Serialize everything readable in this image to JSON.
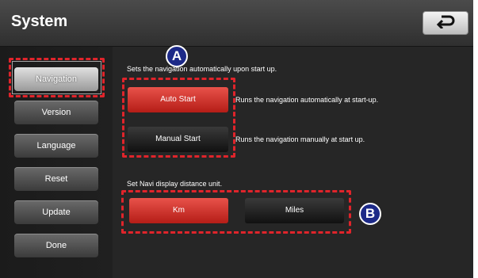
{
  "header": {
    "title": "System",
    "back_icon": "back-arrow-icon"
  },
  "sidebar": {
    "items": [
      {
        "label": "Navigation",
        "active": true
      },
      {
        "label": "Version",
        "active": false
      },
      {
        "label": "Language",
        "active": false
      },
      {
        "label": "Reset",
        "active": false
      },
      {
        "label": "Update",
        "active": false
      },
      {
        "label": "Done",
        "active": false
      }
    ]
  },
  "autostart": {
    "prompt": "Sets the navigation automatically upon start up.",
    "auto_label": "Auto Start",
    "auto_desc": "Runs the navigation automatically at start-up.",
    "manual_label": "Manual Start",
    "manual_desc": "Runs the navigation manually at start up."
  },
  "distance": {
    "prompt": "Set Navi display distance unit.",
    "km_label": "Km",
    "miles_label": "Miles"
  },
  "callouts": {
    "a": "A",
    "b": "B"
  },
  "colors": {
    "highlight_dash": "#e0242b",
    "selected_option": "#c8282a",
    "callout_bg": "#1d2a88"
  }
}
